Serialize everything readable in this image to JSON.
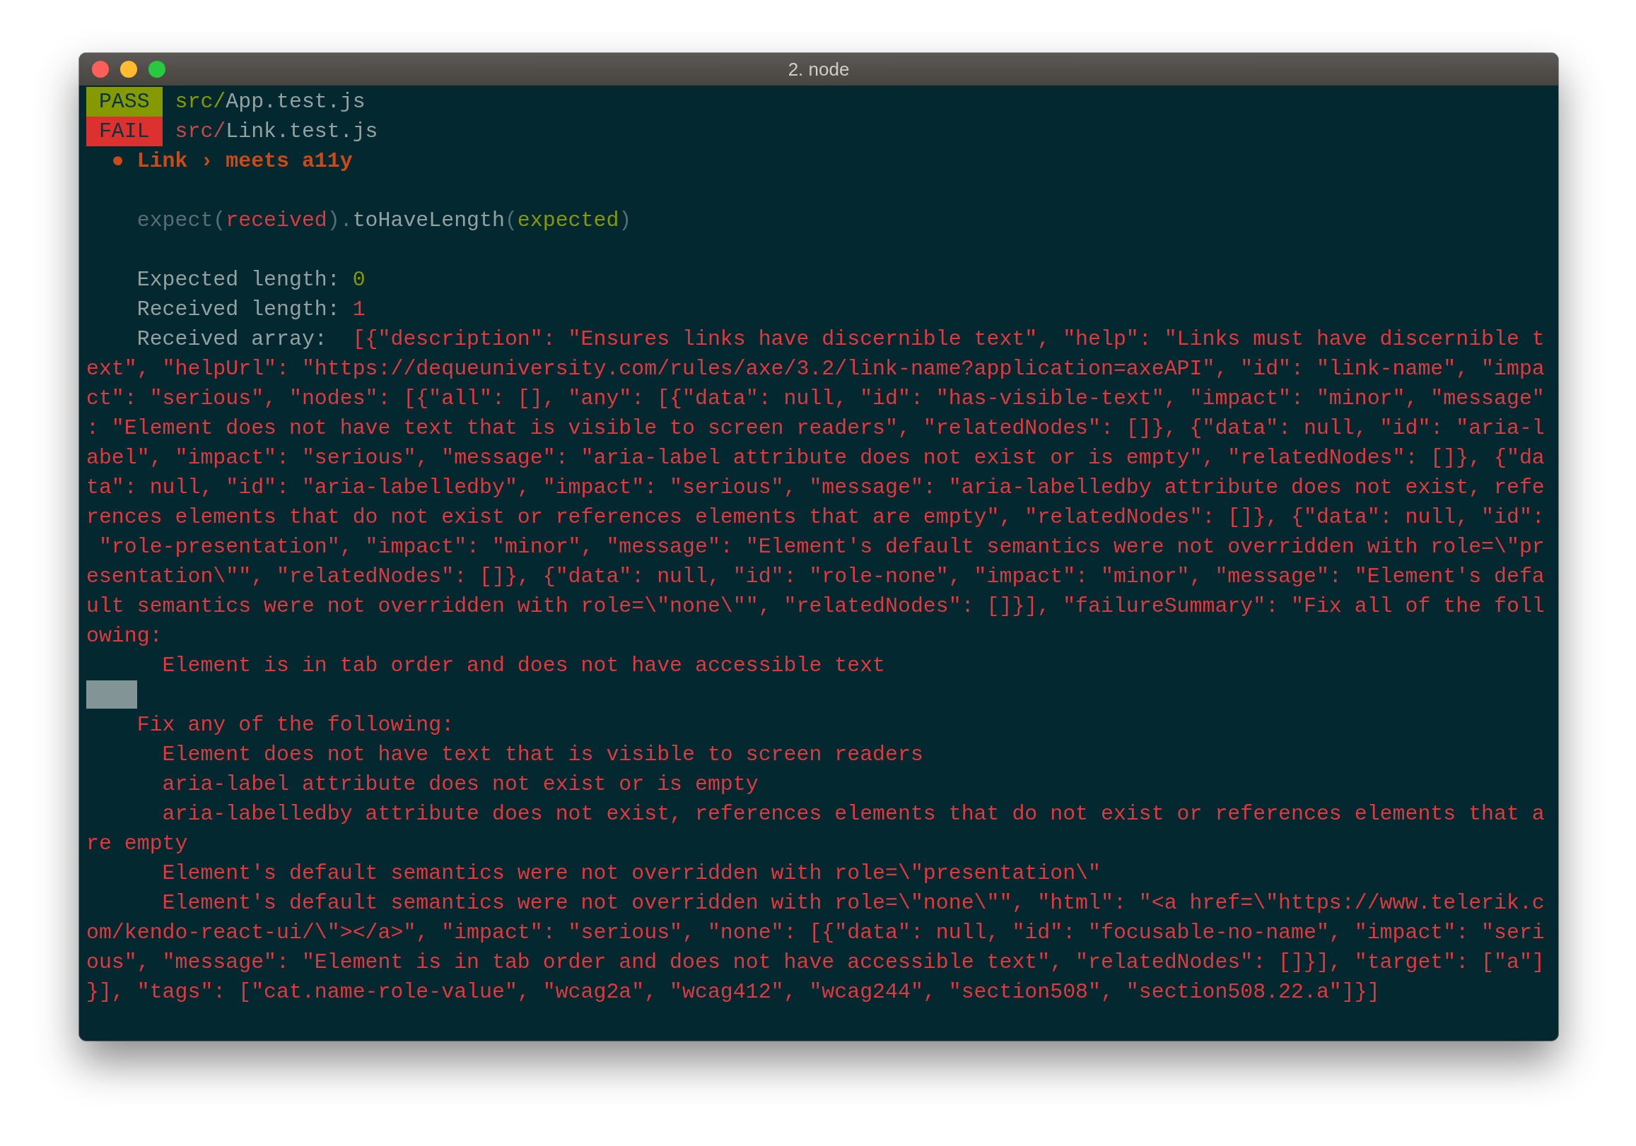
{
  "window": {
    "title": "2. node"
  },
  "lines": [
    {
      "kind": "result",
      "badge": {
        "kind": "pass",
        "text": "PASS"
      },
      "segments": [
        {
          "kind": "path",
          "text": "src/"
        },
        {
          "kind": "file",
          "text": "App.test.js"
        }
      ]
    },
    {
      "kind": "result",
      "badge": {
        "kind": "fail",
        "text": "FAIL"
      },
      "segments": [
        {
          "kind": "path",
          "text": "src/"
        },
        {
          "kind": "file",
          "text": "Link.test.js"
        }
      ]
    },
    {
      "kind": "bullet",
      "segments": [
        {
          "kind": "orange",
          "text": "● Link › meets a11y"
        }
      ]
    },
    {
      "kind": "blank"
    },
    {
      "kind": "indent",
      "segments": [
        {
          "kind": "dim",
          "text": "expect("
        },
        {
          "kind": "red",
          "text": "received"
        },
        {
          "kind": "dim",
          "text": ")."
        },
        {
          "kind": "text",
          "text": "toHaveLength"
        },
        {
          "kind": "dim",
          "text": "("
        },
        {
          "kind": "green",
          "text": "expected"
        },
        {
          "kind": "dim",
          "text": ")"
        }
      ]
    },
    {
      "kind": "blank"
    },
    {
      "kind": "indent",
      "segments": [
        {
          "kind": "text",
          "text": "Expected length: "
        },
        {
          "kind": "green",
          "text": "0"
        }
      ]
    },
    {
      "kind": "indent",
      "segments": [
        {
          "kind": "text",
          "text": "Received length: "
        },
        {
          "kind": "red",
          "text": "1"
        }
      ]
    },
    {
      "kind": "indent",
      "segments": [
        {
          "kind": "text",
          "text": "Received array:  "
        },
        {
          "kind": "red",
          "text": "[{\"description\": \"Ensures links have discernible text\", \"help\": \"Links must have discernible t"
        }
      ]
    },
    {
      "kind": "flush",
      "segments": [
        {
          "kind": "red",
          "text": "ext\", \"helpUrl\": \"https://dequeuniversity.com/rules/axe/3.2/link-name?application=axeAPI\", \"id\": \"link-name\", \"impa"
        }
      ]
    },
    {
      "kind": "flush",
      "segments": [
        {
          "kind": "red",
          "text": "ct\": \"serious\", \"nodes\": [{\"all\": [], \"any\": [{\"data\": null, \"id\": \"has-visible-text\", \"impact\": \"minor\", \"message\""
        }
      ]
    },
    {
      "kind": "flush",
      "segments": [
        {
          "kind": "red",
          "text": ": \"Element does not have text that is visible to screen readers\", \"relatedNodes\": []}, {\"data\": null, \"id\": \"aria-l"
        }
      ]
    },
    {
      "kind": "flush",
      "segments": [
        {
          "kind": "red",
          "text": "abel\", \"impact\": \"serious\", \"message\": \"aria-label attribute does not exist or is empty\", \"relatedNodes\": []}, {\"da"
        }
      ]
    },
    {
      "kind": "flush",
      "segments": [
        {
          "kind": "red",
          "text": "ta\": null, \"id\": \"aria-labelledby\", \"impact\": \"serious\", \"message\": \"aria-labelledby attribute does not exist, refe"
        }
      ]
    },
    {
      "kind": "flush",
      "segments": [
        {
          "kind": "red",
          "text": "rences elements that do not exist or references elements that are empty\", \"relatedNodes\": []}, {\"data\": null, \"id\":"
        }
      ]
    },
    {
      "kind": "flush",
      "segments": [
        {
          "kind": "red",
          "text": " \"role-presentation\", \"impact\": \"minor\", \"message\": \"Element's default semantics were not overridden with role=\\\"pr"
        }
      ]
    },
    {
      "kind": "flush",
      "segments": [
        {
          "kind": "red",
          "text": "esentation\\\"\", \"relatedNodes\": []}, {\"data\": null, \"id\": \"role-none\", \"impact\": \"minor\", \"message\": \"Element's defa"
        }
      ]
    },
    {
      "kind": "flush",
      "segments": [
        {
          "kind": "red",
          "text": "ult semantics were not overridden with role=\\\"none\\\"\", \"relatedNodes\": []}], \"failureSummary\": \"Fix all of the foll"
        }
      ]
    },
    {
      "kind": "flush",
      "segments": [
        {
          "kind": "red",
          "text": "owing:"
        }
      ]
    },
    {
      "kind": "deep",
      "segments": [
        {
          "kind": "red",
          "text": "Element is in tab order and does not have accessible text"
        }
      ]
    },
    {
      "kind": "cursor"
    },
    {
      "kind": "indent",
      "segments": [
        {
          "kind": "red",
          "text": "Fix any of the following:"
        }
      ]
    },
    {
      "kind": "deep",
      "segments": [
        {
          "kind": "red",
          "text": "Element does not have text that is visible to screen readers"
        }
      ]
    },
    {
      "kind": "deep",
      "segments": [
        {
          "kind": "red",
          "text": "aria-label attribute does not exist or is empty"
        }
      ]
    },
    {
      "kind": "deep",
      "segments": [
        {
          "kind": "red",
          "text": "aria-labelledby attribute does not exist, references elements that do not exist or references elements that a"
        }
      ]
    },
    {
      "kind": "flush",
      "segments": [
        {
          "kind": "red",
          "text": "re empty"
        }
      ]
    },
    {
      "kind": "deep",
      "segments": [
        {
          "kind": "red",
          "text": "Element's default semantics were not overridden with role=\\\"presentation\\\""
        }
      ]
    },
    {
      "kind": "deep",
      "segments": [
        {
          "kind": "red",
          "text": "Element's default semantics were not overridden with role=\\\"none\\\"\", \"html\": \"<a href=\\\"https://www.telerik.c"
        }
      ]
    },
    {
      "kind": "flush",
      "segments": [
        {
          "kind": "red",
          "text": "om/kendo-react-ui/\\\"></a>\", \"impact\": \"serious\", \"none\": [{\"data\": null, \"id\": \"focusable-no-name\", \"impact\": \"seri"
        }
      ]
    },
    {
      "kind": "flush",
      "segments": [
        {
          "kind": "red",
          "text": "ous\", \"message\": \"Element is in tab order and does not have accessible text\", \"relatedNodes\": []}], \"target\": [\"a\"]"
        }
      ]
    },
    {
      "kind": "flush",
      "segments": [
        {
          "kind": "red",
          "text": "}], \"tags\": [\"cat.name-role-value\", \"wcag2a\", \"wcag412\", \"wcag244\", \"section508\", \"section508.22.a\"]}]"
        }
      ]
    }
  ]
}
